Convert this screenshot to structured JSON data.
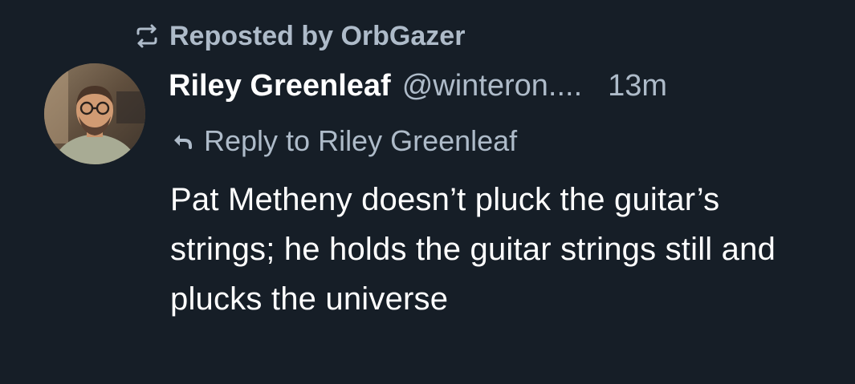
{
  "repost": {
    "icon": "repost-icon",
    "label": "Reposted by OrbGazer"
  },
  "post": {
    "avatar_icon": "avatar",
    "display_name": "Riley Greenleaf",
    "handle": "@winteron....",
    "timestamp": "13m",
    "reply_icon": "reply-arrow-icon",
    "reply_label": "Reply to Riley Greenleaf",
    "text": "Pat Metheny doesn’t pluck the guitar’s strings; he holds the guitar strings still and plucks the universe"
  },
  "colors": {
    "background": "#161e27",
    "primary_text": "#ffffff",
    "secondary_text": "#aebbc9"
  }
}
